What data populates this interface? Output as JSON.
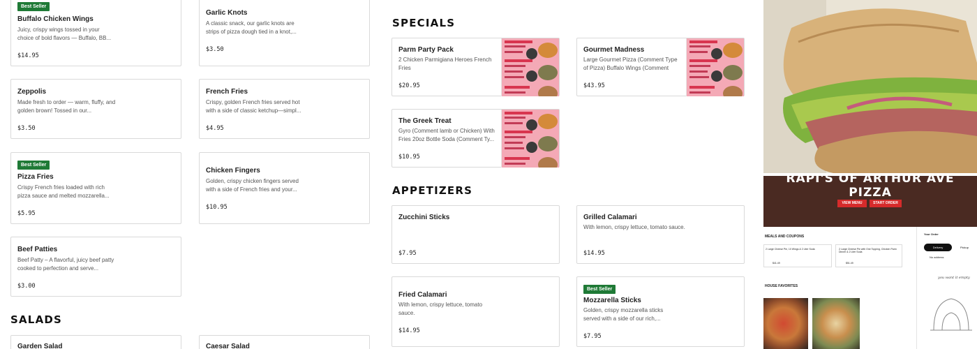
{
  "col_left": {
    "items": [
      {
        "badge": "Best Seller",
        "name": "Buffalo Chicken Wings",
        "desc": "Juicy, crispy wings tossed in your choice of bold flavors — Buffalo, BB...",
        "price": "$14.95"
      },
      {
        "name": "Zeppolis",
        "desc": "Made fresh to order — warm, fluffy, and golden brown! Tossed in our...",
        "price": "$3.50"
      },
      {
        "badge": "Best Seller",
        "name": "Pizza Fries",
        "desc": "Crispy French fries loaded with rich pizza sauce and melted mozzarella...",
        "price": "$5.95"
      },
      {
        "name": "Beef Patties",
        "desc": "Beef Patty – A flavorful, juicy beef patty cooked to perfection and serve...",
        "price": "$3.00"
      }
    ]
  },
  "col_mid": {
    "items": [
      {
        "name": "Garlic Knots",
        "desc": "A classic snack, our garlic knots are strips of pizza dough tied in a knot,...",
        "price": "$3.50"
      },
      {
        "name": "French Fries",
        "desc": "Crispy, golden French fries served hot with a side of classic ketchup—simpl...",
        "price": "$4.95"
      },
      {
        "name": "Chicken Fingers",
        "desc": "Golden, crispy chicken fingers served with a side of French fries and your...",
        "price": "$10.95"
      }
    ]
  },
  "salads": {
    "title": "SALADS",
    "items": [
      {
        "name": "Garden Salad"
      },
      {
        "name": "Caesar Salad"
      }
    ]
  },
  "specials": {
    "title": "SPECIALS",
    "items": [
      {
        "name": "Parm Party Pack",
        "desc": "2 Chicken Parmigiana Heroes French Fries",
        "price": "$20.95"
      },
      {
        "name": "Gourmet Madness",
        "desc": "Large Gourmet Pizza (Comment Type of Pizza) Buffalo Wings (Comment Ty...",
        "price": "$43.95"
      },
      {
        "name": "The Greek Treat",
        "desc": "Gyro (Comment lamb or Chicken) With Fries 20oz Bottle Soda (Comment Ty...",
        "price": "$10.95"
      }
    ]
  },
  "appetizers": {
    "title": "APPETIZERS",
    "items": [
      {
        "name": "Zucchini Sticks",
        "desc": "",
        "price": "$7.95"
      },
      {
        "name": "Grilled Calamari",
        "desc": "With lemon, crispy lettuce, tomato sauce.",
        "price": "$14.95"
      },
      {
        "name": "Fried Calamari",
        "desc": "With lemon, crispy lettuce, tomato sauce.",
        "price": "$14.95"
      },
      {
        "badge": "Best Seller",
        "name": "Mozzarella Sticks",
        "desc": "Golden, crispy mozzarella sticks served with a side of our rich,...",
        "price": "$7.95"
      }
    ]
  },
  "promo": {
    "hero_title_1": "RAPI'S OF ARTHUR AVE",
    "hero_title_2": "PIZZA",
    "view_menu": "VIEW MENU",
    "start_order": "START ORDER",
    "deals_title": "MEALS AND COUPONS",
    "deal_1": "2 Large Cheese Pie, 10 Wings & 2 Liter Soda",
    "deal_2": "2 Large Cheese Pie with One Topping, Chicken Parm Dinner & 2 Liter Soda",
    "deal_1_price": "$41.49",
    "deal_2_price": "$51.49",
    "favorites_title": "HOUSE FAVORITES",
    "order_title": "Your Order",
    "tab_delivery": "Delivery",
    "tab_pickup": "Pickup",
    "no_address": "No address",
    "handwrite": "you want it empty"
  },
  "colors": {
    "badge": "#1f7a36",
    "border": "#d9d9d9",
    "promo_red": "#d62b2b"
  }
}
